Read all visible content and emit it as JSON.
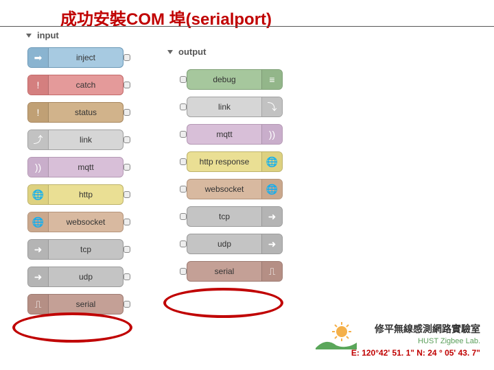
{
  "title": "成功安裝COM 埠(serialport)",
  "categories": {
    "input": "input",
    "output": "output"
  },
  "input_nodes": [
    {
      "label": "inject",
      "cls": "inject",
      "icon": "➡"
    },
    {
      "label": "catch",
      "cls": "catch",
      "icon": "!"
    },
    {
      "label": "status",
      "cls": "status",
      "icon": "!"
    },
    {
      "label": "link",
      "cls": "link",
      "icon": "⤴"
    },
    {
      "label": "mqtt",
      "cls": "mqtt",
      "icon": "))"
    },
    {
      "label": "http",
      "cls": "http",
      "icon": "🌐"
    },
    {
      "label": "websocket",
      "cls": "ws",
      "icon": "🌐"
    },
    {
      "label": "tcp",
      "cls": "tcp",
      "icon": "➜"
    },
    {
      "label": "udp",
      "cls": "udp",
      "icon": "➜"
    },
    {
      "label": "serial",
      "cls": "serial",
      "icon": "⎍"
    }
  ],
  "output_nodes": [
    {
      "label": "debug",
      "cls": "debug",
      "icon": "≡"
    },
    {
      "label": "link",
      "cls": "link",
      "icon": "⤵"
    },
    {
      "label": "mqtt",
      "cls": "mqtt",
      "icon": "))"
    },
    {
      "label": "http response",
      "cls": "http",
      "icon": "🌐"
    },
    {
      "label": "websocket",
      "cls": "ws",
      "icon": "🌐"
    },
    {
      "label": "tcp",
      "cls": "tcp",
      "icon": "➜"
    },
    {
      "label": "udp",
      "cls": "udp",
      "icon": "➜"
    },
    {
      "label": "serial",
      "cls": "serial",
      "icon": "⎍"
    }
  ],
  "footer": {
    "lab_name": "修平無線感測網路實驗室",
    "lab_sub": "HUST Zigbee Lab.",
    "coords": "E: 120°42' 51. 1\"  N: 24 ° 05' 43. 7\""
  }
}
